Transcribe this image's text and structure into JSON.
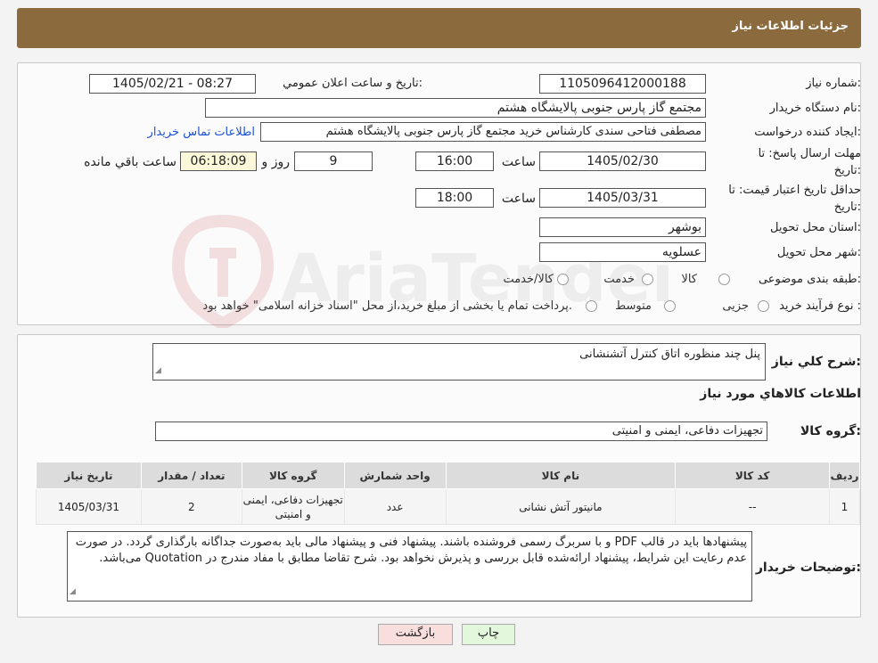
{
  "header": {
    "title": "جزئیات اطلاعات نیاز"
  },
  "form": {
    "need_number_label": "شماره نیاز:",
    "need_number": "1105096412000188",
    "announce_label": "تاریخ و ساعت اعلان عمومي:",
    "announce_value": "1405/02/21 - 08:27",
    "buyer_org_label": "نام دستگاه خریدار:",
    "buyer_org": "مجتمع گاز پارس جنوبی  پالایشگاه هشتم",
    "requester_label": "ایجاد کننده درخواست:",
    "requester": "مصطفی فتاحی سندی کارشناس خرید مجتمع گاز پارس جنوبی  پالایشگاه هشتم",
    "contact_link": "اطلاعات تماس خریدار",
    "deadline_label_1": "مهلت ارسال پاسخ: تا",
    "deadline_label_2": "تاریخ:",
    "deadline_date": "1405/02/30",
    "time_label": "ساعت",
    "deadline_time": "16:00",
    "days_value": "9",
    "days_label": "روز و",
    "remaining_value": "06:18:09",
    "remaining_label": "ساعت باقي مانده",
    "validity_label_1": "حداقل تاریخ اعتبار قیمت: تا",
    "validity_label_2": "تاریخ:",
    "validity_date": "1405/03/31",
    "validity_time_label": "ساعت",
    "validity_time": "18:00",
    "province_label": "استان محل تحویل:",
    "province": "بوشهر",
    "city_label": "شهر محل تحویل:",
    "city": "عسلویه",
    "category_label": "طبقه بندی موضوعی:",
    "category_options": [
      "کالا",
      "خدمت",
      "کالا/خدمت"
    ],
    "process_label": "نوع فرآیند خرید :",
    "process_options": [
      "جزیی",
      "متوسط"
    ],
    "process_note": "پرداخت تمام یا بخشی از مبلغ خرید،از محل \"اسناد خزانه اسلامی\" خواهد بود."
  },
  "details": {
    "summary_label": "شرح کلي نیاز:",
    "summary": "پنل چند منظوره اتاق کنترل آتشنشانی",
    "items_title": "اطلاعات کالاهاي مورد نیاز",
    "group_label": "گروه کالا:",
    "group": "تجهیزات دفاعی، ایمنی و امنیتی",
    "table": {
      "headers": [
        "ردیف",
        "کد کالا",
        "نام کالا",
        "واحد شمارش",
        "گروه کالا",
        "تعداد / مقدار",
        "تاریخ نیاز"
      ],
      "rows": [
        [
          "1",
          "--",
          "مانیتور آتش نشانی",
          "عدد",
          "تجهیزات دفاعی، ایمنی و امنیتی",
          "2",
          "1405/03/31"
        ]
      ]
    },
    "buyer_notes_label": "توضیحات خریدار:",
    "buyer_notes": "پیشنهادها باید در قالب PDF و با سربرگ رسمی فروشنده باشند. پیشنهاد فنی و پیشنهاد مالی باید به‌صورت جداگانه بارگذاری گردد. در صورت عدم رعایت این شرایط، پیشنهاد ارائه‌شده قابل بررسی و پذیرش نخواهد بود. شرح تقاضا مطابق با مفاد مندرج در Quotation می‌باشد."
  },
  "buttons": {
    "print": "چاپ",
    "back": "بازگشت"
  },
  "watermark": {
    "text": "AriaTender.neT"
  },
  "colors": {
    "header": "#8b6a3e",
    "link": "#1a4fd6",
    "back_btn": "#f9dede",
    "print_btn": "#e3f7dc"
  }
}
